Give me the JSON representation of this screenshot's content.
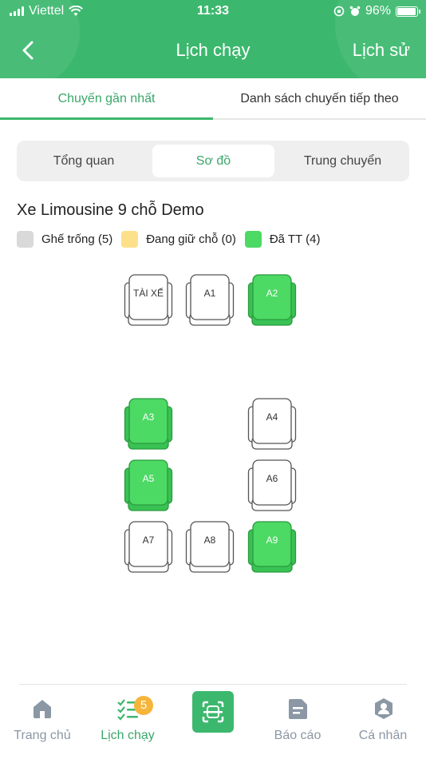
{
  "status_bar": {
    "carrier": "Viettel",
    "time": "11:33",
    "battery": "96%",
    "battery_level": 0.96
  },
  "header": {
    "title": "Lịch chạy",
    "history_label": "Lịch sử"
  },
  "tabs": [
    {
      "label": "Chuyến gần nhất",
      "active": true
    },
    {
      "label": "Danh sách chuyến tiếp theo",
      "active": false
    }
  ],
  "segments": [
    {
      "label": "Tổng quan",
      "active": false
    },
    {
      "label": "Sơ đồ",
      "active": true
    },
    {
      "label": "Trung chuyển",
      "active": false
    }
  ],
  "vehicle": {
    "title": "Xe Limousine 9 chỗ Demo"
  },
  "legend": [
    {
      "label": "Ghế trống (5)",
      "color": "#d9d9d9"
    },
    {
      "label": "Đang giữ chỗ (0)",
      "color": "#fde08a"
    },
    {
      "label": "Đã TT (4)",
      "color": "#4cd964"
    }
  ],
  "seats": [
    {
      "label": "TÀI XẾ",
      "status": "empty"
    },
    {
      "label": "A1",
      "status": "empty"
    },
    {
      "label": "A2",
      "status": "paid"
    },
    {
      "label": "A3",
      "status": "paid"
    },
    {
      "label": "A4",
      "status": "empty"
    },
    {
      "label": "A5",
      "status": "paid"
    },
    {
      "label": "A6",
      "status": "empty"
    },
    {
      "label": "A7",
      "status": "empty"
    },
    {
      "label": "A8",
      "status": "empty"
    },
    {
      "label": "A9",
      "status": "paid"
    }
  ],
  "bottom_nav": [
    {
      "label": "Trang chủ",
      "icon": "home-icon",
      "active": false
    },
    {
      "label": "Lịch chạy",
      "icon": "schedule-list-icon",
      "active": true,
      "badge": "5"
    },
    {
      "label": "",
      "icon": "scan-icon",
      "active": false
    },
    {
      "label": "Báo cáo",
      "icon": "report-icon",
      "active": false
    },
    {
      "label": "Cá nhân",
      "icon": "profile-icon",
      "active": false
    }
  ],
  "colors": {
    "brand": "#3cb86e",
    "active_text": "#3aa76a",
    "paid_seat": "#4cd964",
    "inactive_nav": "#8b97a4"
  }
}
